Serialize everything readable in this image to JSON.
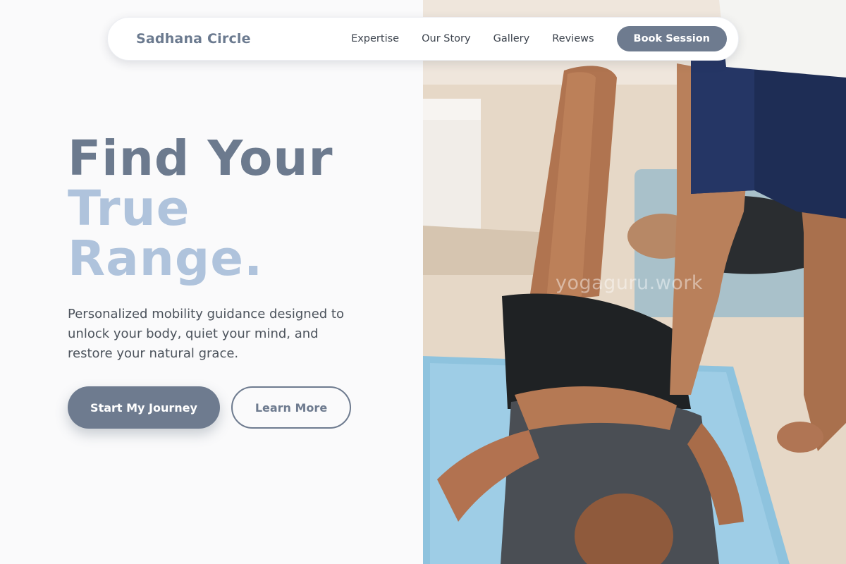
{
  "nav": {
    "brand": "Sadhana Circle",
    "links": [
      "Expertise",
      "Our Story",
      "Gallery",
      "Reviews"
    ],
    "book_button": "Book Session"
  },
  "hero": {
    "headline_line1": "Find Your",
    "headline_line2": "True",
    "headline_line3": "Range.",
    "subtitle": "Personalized mobility guidance designed to unlock your body, quiet your mind, and restore your natural grace.",
    "primary_cta": "Start My Journey",
    "secondary_cta": "Learn More"
  },
  "photo": {
    "watermark": "yogaguru.work",
    "subject": "yoga instructor assisting a leg stretch on a beach towel"
  },
  "colors": {
    "accent": "#6e7b8f",
    "headline_light": "#afc3dc",
    "headline_dark": "#6c7a8e",
    "text": "#4c535c"
  }
}
